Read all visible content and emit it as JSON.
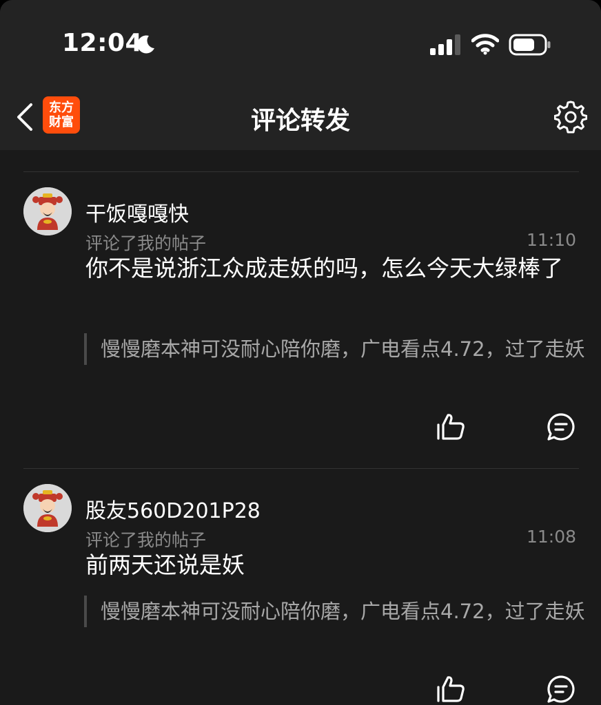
{
  "status_bar": {
    "time": "12:04"
  },
  "nav": {
    "title": "评论转发",
    "logo_line1": "东方",
    "logo_line2": "财富"
  },
  "comments": [
    {
      "username": "干饭嘎嘎快",
      "action": "评论了我的帖子",
      "time": "11:10",
      "text": "你不是说浙江众成走妖的吗，怎么今天大绿棒了",
      "quote": "慢慢磨本神可没耐心陪你磨，广电看点4.72，过了走妖"
    },
    {
      "username": "股友560D201P28",
      "action": "评论了我的帖子",
      "time": "11:08",
      "text": "前两天还说是妖",
      "quote": "慢慢磨本神可没耐心陪你磨，广电看点4.72，过了走妖"
    }
  ],
  "colors": {
    "brand": "#ff4d0c",
    "background": "#1a1a1a"
  }
}
